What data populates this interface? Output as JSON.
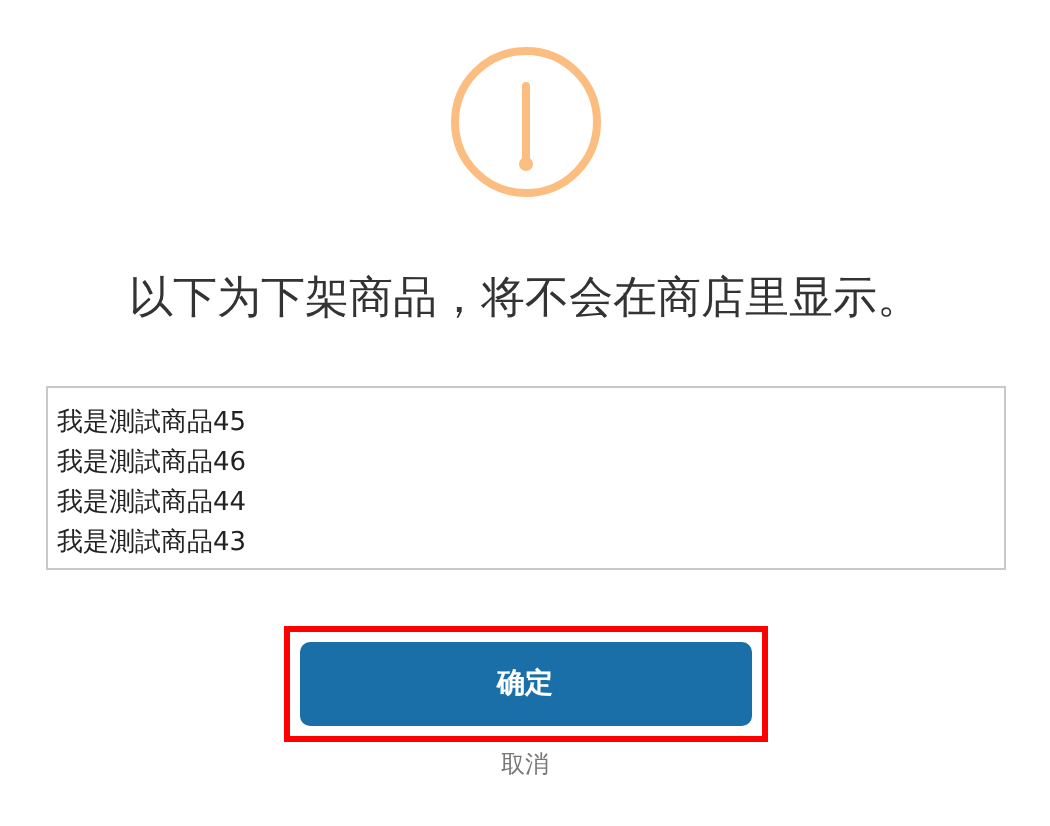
{
  "dialog": {
    "message": "以下为下架商品，将不会在商店里显示。",
    "items": [
      "我是測試商品45",
      "我是測試商品46",
      "我是測試商品44",
      "我是測試商品43"
    ],
    "confirm_button": {
      "label": "确定",
      "highlighted": true
    },
    "cancel_link": {
      "label": "取消"
    }
  }
}
